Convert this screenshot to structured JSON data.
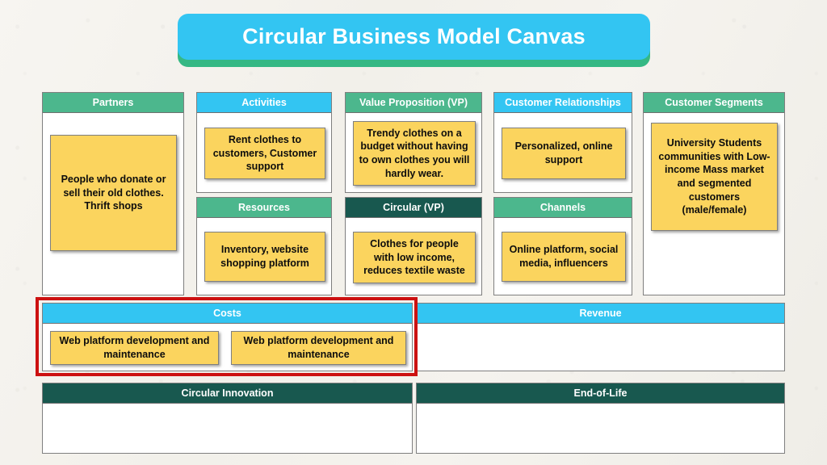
{
  "title": {
    "text": "Circular Business Model Canvas",
    "banner_color": "#33c5f2",
    "banner_shadow_color": "#35b884"
  },
  "palette": {
    "green_header": "#4cb78d",
    "cyan_header": "#33c5f2",
    "teal_header": "#18584f",
    "note_yellow": "#fbd45e",
    "highlight_red": "#cc1111",
    "page_background": "#f4f2ed"
  },
  "blocks": {
    "partners": {
      "header": "Partners",
      "header_style": "green",
      "notes": [
        "People who donate or sell their old clothes. Thrift shops"
      ]
    },
    "activities": {
      "header": "Activities",
      "header_style": "cyan",
      "notes": [
        "Rent clothes to customers, Customer support"
      ]
    },
    "resources": {
      "header": "Resources",
      "header_style": "green",
      "notes": [
        "Inventory, website shopping platform"
      ]
    },
    "value_proposition": {
      "header": "Value Proposition (VP)",
      "header_style": "green",
      "notes": [
        "Trendy clothes on a budget without having to own clothes you will hardly wear."
      ]
    },
    "circular_vp": {
      "header": "Circular (VP)",
      "header_style": "teal",
      "notes": [
        "Clothes for people with low income, reduces textile waste"
      ]
    },
    "customer_relationships": {
      "header": "Customer Relationships",
      "header_style": "cyan",
      "notes": [
        "Personalized, online support"
      ]
    },
    "channels": {
      "header": "Channels",
      "header_style": "green",
      "notes": [
        "Online platform, social media, influencers"
      ]
    },
    "customer_segments": {
      "header": "Customer Segments",
      "header_style": "green",
      "notes": [
        "University Students communities with Low-income Mass market and segmented customers (male/female)"
      ]
    },
    "costs": {
      "header": "Costs",
      "header_style": "cyan",
      "highlighted": true,
      "notes": [
        "Web platform development and maintenance",
        "Web platform development and maintenance"
      ]
    },
    "revenue": {
      "header": "Revenue",
      "header_style": "cyan",
      "notes": []
    },
    "circular_innovation": {
      "header": "Circular Innovation",
      "header_style": "teal",
      "notes": []
    },
    "end_of_life": {
      "header": "End-of-Life",
      "header_style": "teal",
      "notes": []
    }
  }
}
